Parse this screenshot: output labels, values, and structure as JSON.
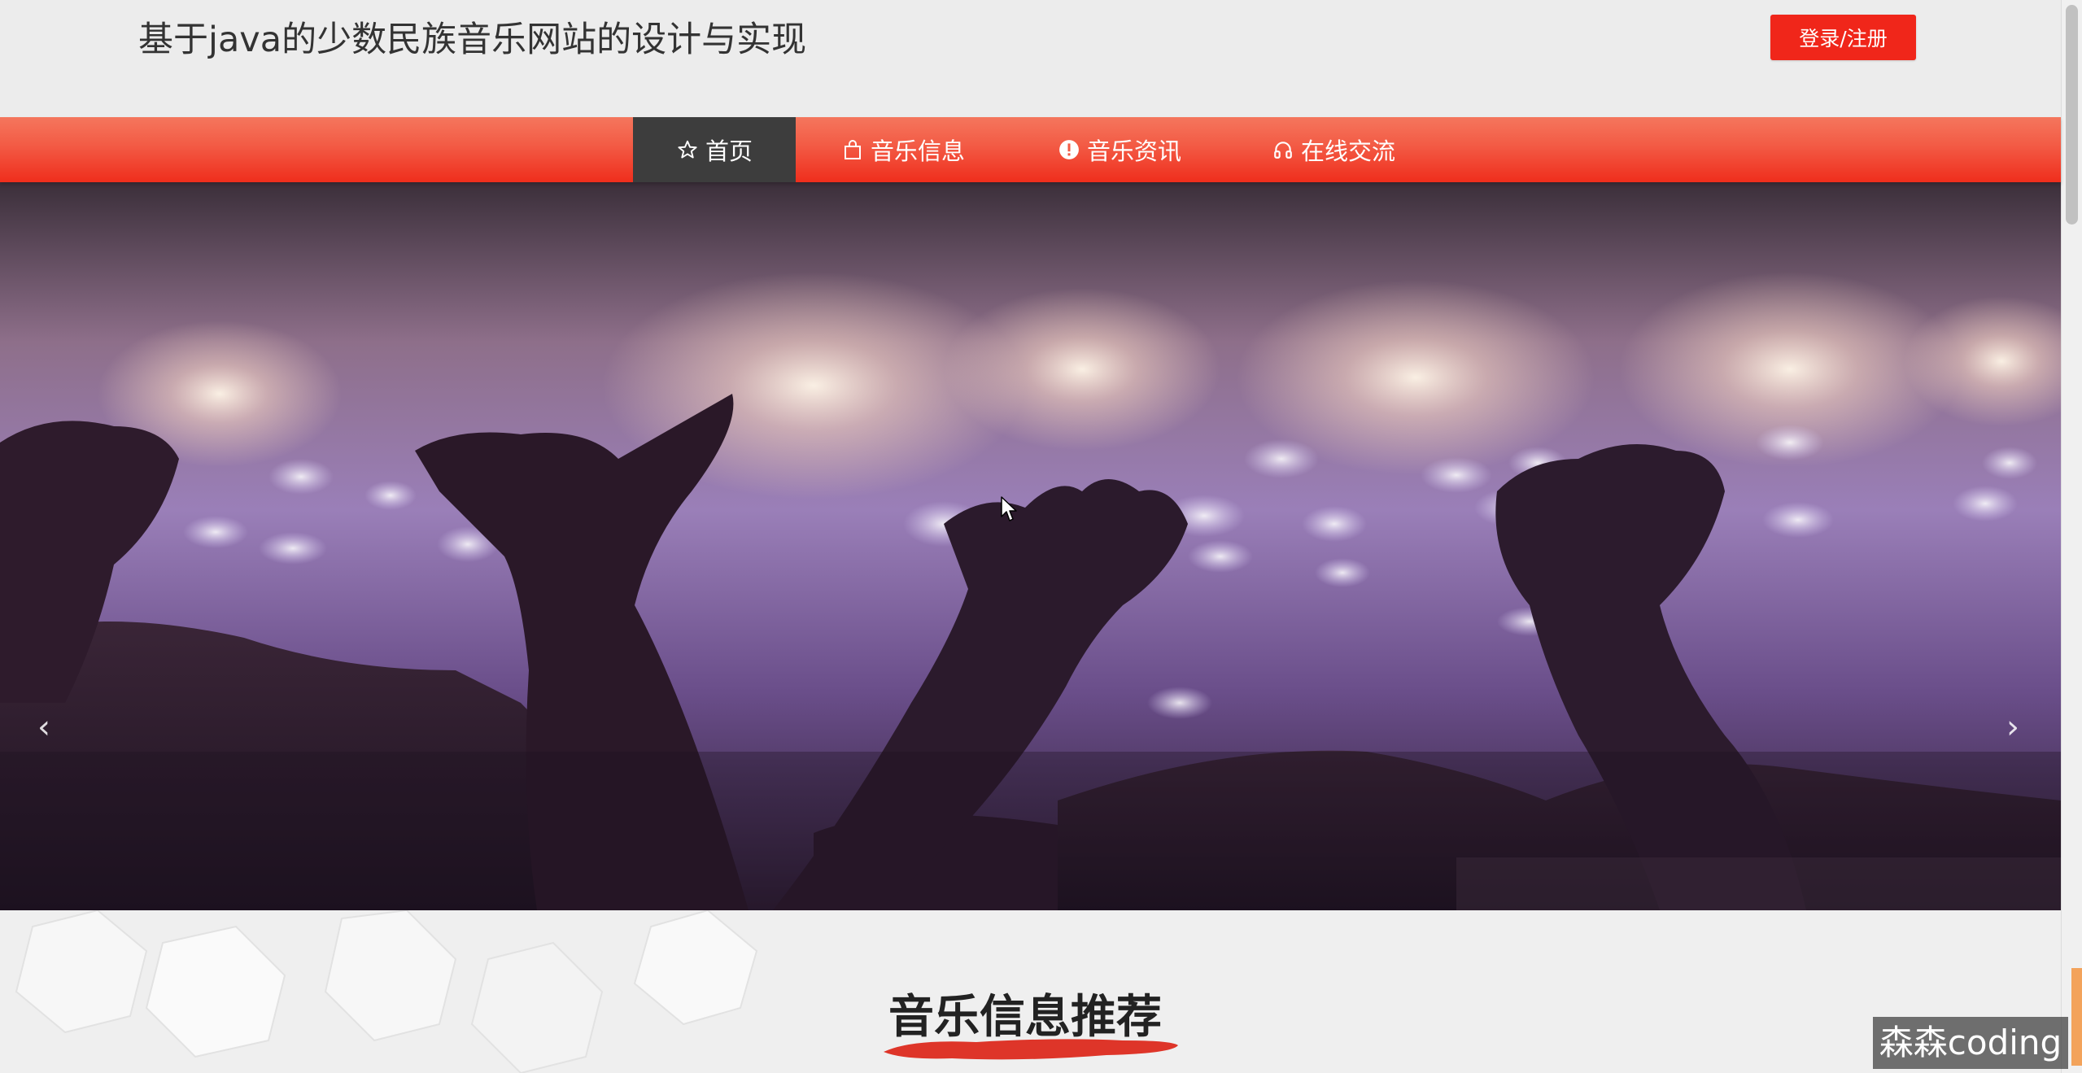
{
  "header": {
    "site_title": "基于java的少数民族音乐网站的设计与实现",
    "login_label": "登录/注册"
  },
  "nav": {
    "items": [
      {
        "label": "首页",
        "icon": "star-icon",
        "active": true
      },
      {
        "label": "音乐信息",
        "icon": "shopping-bag-icon",
        "active": false
      },
      {
        "label": "音乐资讯",
        "icon": "info-circle-icon",
        "active": false
      },
      {
        "label": "在线交流",
        "icon": "headphones-icon",
        "active": false
      }
    ]
  },
  "carousel": {
    "prev_icon": "chevron-left-icon",
    "next_icon": "chevron-right-icon",
    "prev_glyph": "‹",
    "next_glyph": "›"
  },
  "section": {
    "title": "音乐信息推荐"
  },
  "watermark": {
    "text": "森森coding"
  },
  "colors": {
    "brand_red": "#f0261a",
    "nav_active": "#3d3d3d",
    "page_bg": "#ececec"
  }
}
